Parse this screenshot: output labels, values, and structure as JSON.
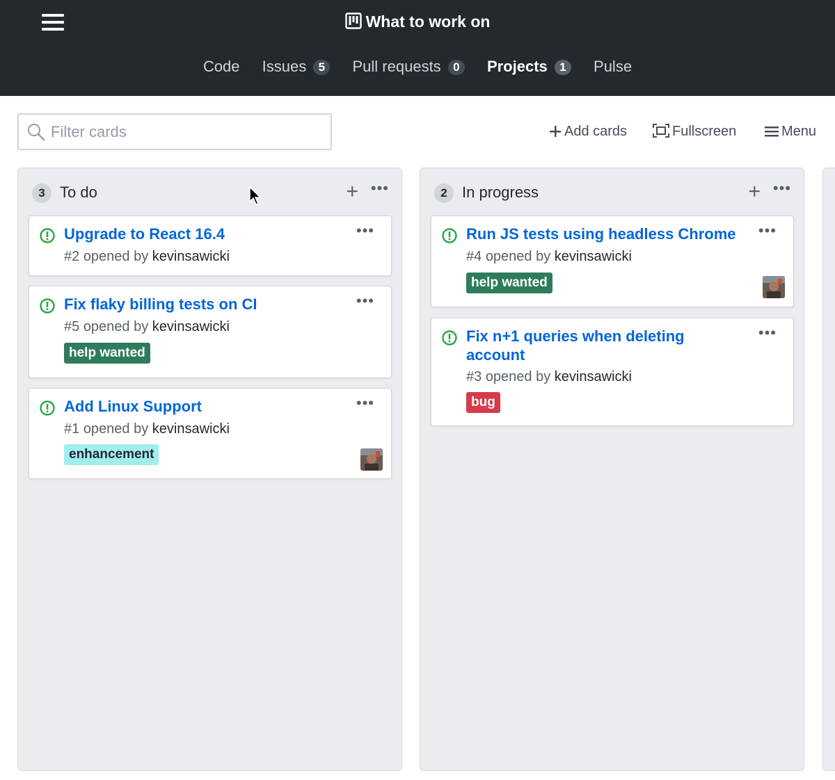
{
  "header": {
    "title": "What to work on",
    "icons": {
      "menu": "hamburger-icon",
      "project": "project-board-icon"
    }
  },
  "nav": [
    {
      "label": "Code",
      "count": null,
      "active": false
    },
    {
      "label": "Issues",
      "count": "5",
      "active": false
    },
    {
      "label": "Pull requests",
      "count": "0",
      "active": false
    },
    {
      "label": "Projects",
      "count": "1",
      "active": true
    },
    {
      "label": "Pulse",
      "count": null,
      "active": false
    }
  ],
  "toolbar": {
    "filter_placeholder": "Filter cards",
    "add_cards_label": "Add cards",
    "fullscreen_label": "Fullscreen",
    "menu_label": "Menu"
  },
  "columns": [
    {
      "count": "3",
      "name": "To do",
      "cards": [
        {
          "title": "Upgrade to React 16.4",
          "number": "#2",
          "opened_text": "opened by",
          "author": "kevinsawicki",
          "label": null,
          "avatar": false
        },
        {
          "title": "Fix flaky billing tests on CI",
          "number": "#5",
          "opened_text": "opened by",
          "author": "kevinsawicki",
          "label": "help wanted",
          "avatar": false
        },
        {
          "title": "Add Linux Support",
          "number": "#1",
          "opened_text": "opened by",
          "author": "kevinsawicki",
          "label": "enhancement",
          "avatar": true
        }
      ]
    },
    {
      "count": "2",
      "name": "In progress",
      "cards": [
        {
          "title": "Run JS tests using headless Chrome",
          "number": "#4",
          "opened_text": "opened by",
          "author": "kevinsawicki",
          "label": "help wanted",
          "avatar": true
        },
        {
          "title": "Fix n+1 queries when deleting account",
          "number": "#3",
          "opened_text": "opened by",
          "author": "kevinsawicki",
          "label": "bug",
          "avatar": false
        }
      ]
    }
  ],
  "colors": {
    "header_bg": "#24292e",
    "link": "#0366d6",
    "issue_open": "#28a745",
    "label_help_wanted": "#2f7c5c",
    "label_bug": "#d73a49",
    "label_enhancement": "#a2eeef"
  }
}
